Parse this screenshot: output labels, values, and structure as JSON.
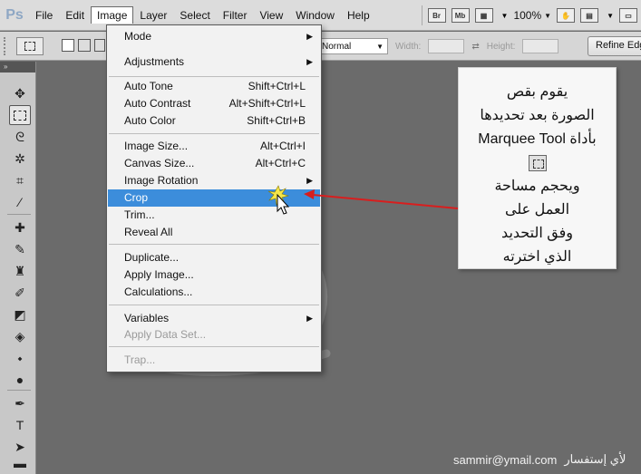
{
  "app": {
    "logo": "Ps"
  },
  "menubar": {
    "items": [
      "File",
      "Edit",
      "Image",
      "Layer",
      "Select",
      "Filter",
      "View",
      "Window",
      "Help"
    ],
    "active": "Image",
    "bridge_label": "Br",
    "minibridge_label": "Mb",
    "zoom": "100%"
  },
  "options": {
    "style_value": "Normal",
    "width_label": "Width:",
    "height_label": "Height:",
    "refine_label": "Refine Edge"
  },
  "image_menu": {
    "items": [
      {
        "label": "Mode",
        "shortcut": "",
        "submenu": true
      },
      {
        "label": "Adjustments",
        "shortcut": "",
        "submenu": true
      },
      {
        "label": "Auto Tone",
        "shortcut": "Shift+Ctrl+L"
      },
      {
        "label": "Auto Contrast",
        "shortcut": "Alt+Shift+Ctrl+L"
      },
      {
        "label": "Auto Color",
        "shortcut": "Shift+Ctrl+B"
      },
      {
        "label": "Image Size...",
        "shortcut": "Alt+Ctrl+I"
      },
      {
        "label": "Canvas Size...",
        "shortcut": "Alt+Ctrl+C"
      },
      {
        "label": "Image Rotation",
        "shortcut": "",
        "submenu": true
      },
      {
        "label": "Crop",
        "shortcut": "",
        "highlighted": true
      },
      {
        "label": "Trim...",
        "shortcut": ""
      },
      {
        "label": "Reveal All",
        "shortcut": ""
      },
      {
        "label": "Duplicate...",
        "shortcut": ""
      },
      {
        "label": "Apply Image...",
        "shortcut": ""
      },
      {
        "label": "Calculations...",
        "shortcut": ""
      },
      {
        "label": "Variables",
        "shortcut": "",
        "submenu": true
      },
      {
        "label": "Apply Data Set...",
        "shortcut": "",
        "disabled": true
      },
      {
        "label": "Trap...",
        "shortcut": "",
        "disabled": true
      }
    ]
  },
  "callout": {
    "line1": "يقوم بقص",
    "line2": "الصورة بعد تحديدها",
    "line3_rtl": "بأداة",
    "line3_ltr": "Marquee Tool",
    "line4": "ويحجم مساحة",
    "line5": "العمل على",
    "line6": "وفق التحديد",
    "line7": "الذي اخترته"
  },
  "footer": {
    "email": "sammir@ymail.com",
    "label": "لأي إستفسار"
  },
  "colors": {
    "highlight": "#3c8ddb",
    "arrow": "#d81e1e",
    "canvas": "#6b6b6b"
  }
}
